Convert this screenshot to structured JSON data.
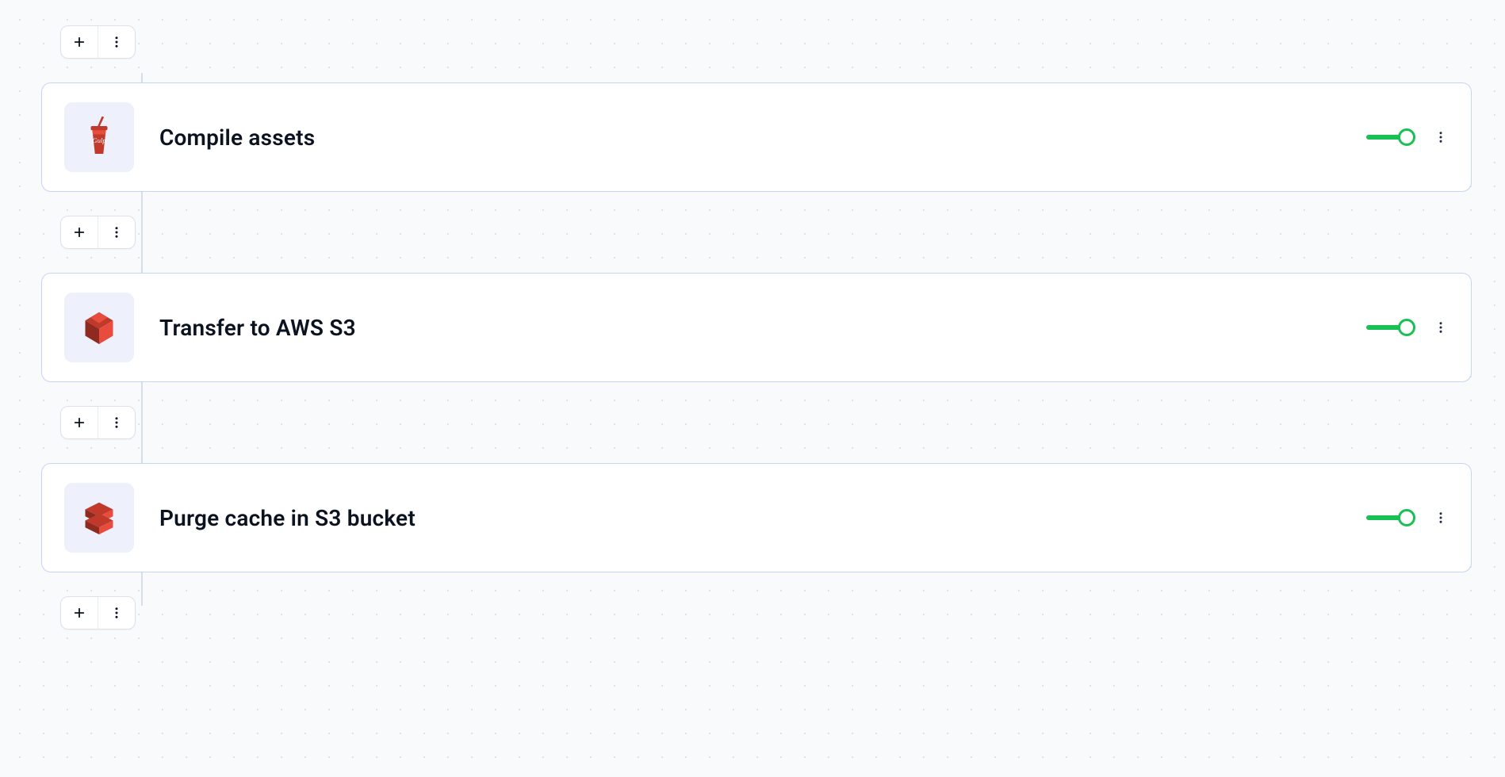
{
  "pipeline": {
    "actions": [
      {
        "title": "Compile assets",
        "icon": "gulp",
        "enabled": true
      },
      {
        "title": "Transfer to AWS S3",
        "icon": "aws-s3",
        "enabled": true
      },
      {
        "title": "Purge cache in S3 bucket",
        "icon": "aws-cloudfront",
        "enabled": true
      }
    ]
  },
  "colors": {
    "cardBorder": "#c6d5f4",
    "iconTile": "#eef1fb",
    "toggleGreen": "#19c155"
  }
}
